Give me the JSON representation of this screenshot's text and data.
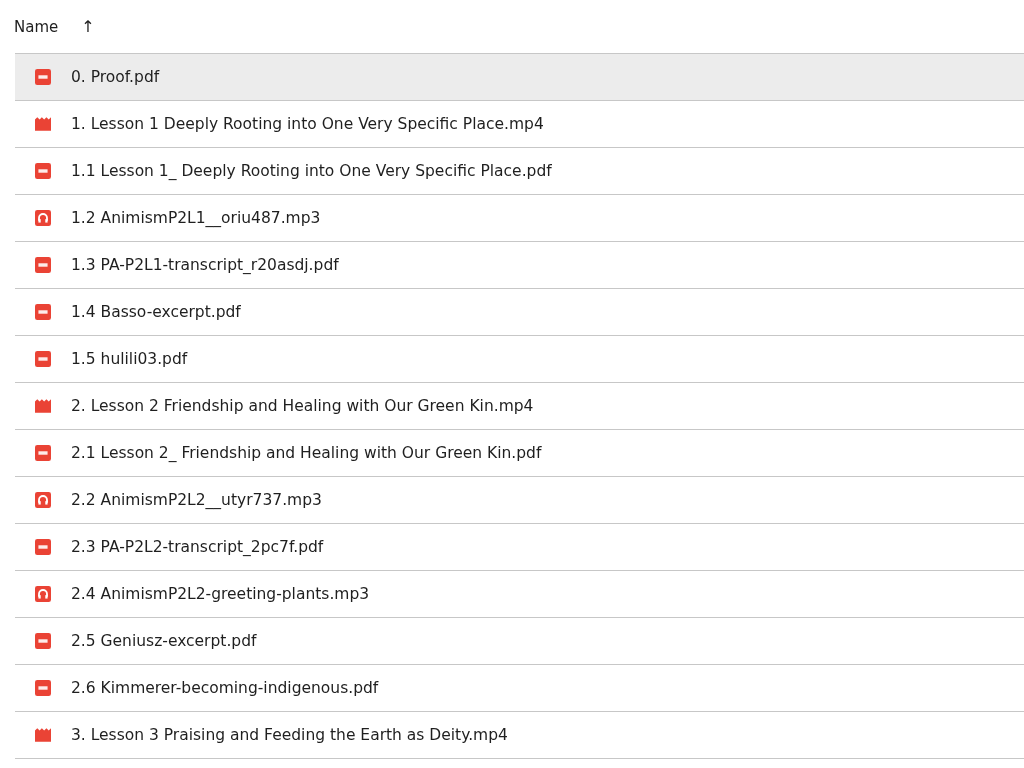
{
  "header": {
    "label": "Name",
    "sort_icon": "↑"
  },
  "files": [
    {
      "name": "0. Proof.pdf",
      "kind": "pdf",
      "selected": true
    },
    {
      "name": "1. Lesson 1 Deeply Rooting into One Very Specific Place.mp4",
      "kind": "video",
      "selected": false
    },
    {
      "name": "1.1 Lesson 1_ Deeply Rooting into One Very Specific Place.pdf",
      "kind": "pdf",
      "selected": false
    },
    {
      "name": "1.2 AnimismP2L1__oriu487.mp3",
      "kind": "audio",
      "selected": false
    },
    {
      "name": "1.3 PA-P2L1-transcript_r20asdj.pdf",
      "kind": "pdf",
      "selected": false
    },
    {
      "name": "1.4 Basso-excerpt.pdf",
      "kind": "pdf",
      "selected": false
    },
    {
      "name": "1.5 hulili03.pdf",
      "kind": "pdf",
      "selected": false
    },
    {
      "name": "2. Lesson 2 Friendship and Healing with Our Green Kin.mp4",
      "kind": "video",
      "selected": false
    },
    {
      "name": "2.1 Lesson 2_ Friendship and Healing with Our Green Kin.pdf",
      "kind": "pdf",
      "selected": false
    },
    {
      "name": "2.2 AnimismP2L2__utyr737.mp3",
      "kind": "audio",
      "selected": false
    },
    {
      "name": "2.3 PA-P2L2-transcript_2pc7f.pdf",
      "kind": "pdf",
      "selected": false
    },
    {
      "name": "2.4 AnimismP2L2-greeting-plants.mp3",
      "kind": "audio",
      "selected": false
    },
    {
      "name": "2.5 Geniusz-excerpt.pdf",
      "kind": "pdf",
      "selected": false
    },
    {
      "name": "2.6 Kimmerer-becoming-indigenous.pdf",
      "kind": "pdf",
      "selected": false
    },
    {
      "name": "3. Lesson 3 Praising and Feeding the Earth as Deity.mp4",
      "kind": "video",
      "selected": false
    }
  ]
}
